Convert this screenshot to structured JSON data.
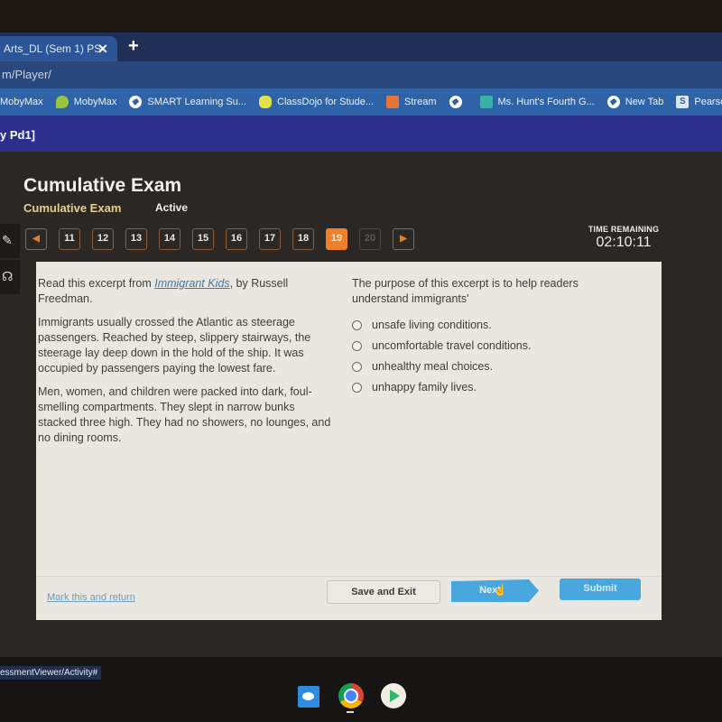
{
  "browser": {
    "tab_title": "Arts_DL (Sem 1) PS",
    "tab_close": "✕",
    "new_tab": "+",
    "url": "m/Player/",
    "bookmarks": [
      {
        "label": "MobyMax",
        "icon": "mobymax-icon"
      },
      {
        "label": "MobyMax",
        "icon": "mobymax-apple-icon"
      },
      {
        "label": "SMART Learning Su...",
        "icon": "globe-icon"
      },
      {
        "label": "ClassDojo for Stude...",
        "icon": "classdojo-icon"
      },
      {
        "label": "Stream",
        "icon": "google-classroom-icon"
      },
      {
        "label": "",
        "icon": "globe-icon"
      },
      {
        "label": "Ms. Hunt's Fourth G...",
        "icon": "google-classroom-icon"
      },
      {
        "label": "New Tab",
        "icon": "globe-icon"
      },
      {
        "label": "Pearson",
        "icon": "pearson-icon"
      }
    ]
  },
  "lms": {
    "header_title": "y Pd1]"
  },
  "activity": {
    "title": "Cumulative Exam",
    "subtitle": "Cumulative Exam",
    "status": "Active",
    "question_nav": {
      "prev_label": "◀",
      "next_label": "▶",
      "questions": [
        "11",
        "12",
        "13",
        "14",
        "15",
        "16",
        "17",
        "18",
        "19",
        "20"
      ],
      "current": "19",
      "disabled": [
        "20"
      ]
    },
    "timer": {
      "label": "TIME REMAINING",
      "value": "02:10:11"
    }
  },
  "question": {
    "intro_prefix": "Read this excerpt from ",
    "book_title": "Immigrant Kids",
    "intro_suffix": ", by Russell Freedman.",
    "paragraphs": [
      "Immigrants usually crossed the Atlantic as steerage passengers. Reached by steep, slippery stairways, the steerage lay deep down in the hold of the ship. It was occupied by passengers paying the lowest fare.",
      "Men, women, and children were packed into dark, foul-smelling compartments. They slept in narrow bunks stacked three high. They had no showers, no lounges, and no dining rooms."
    ],
    "prompt": "The purpose of this excerpt is to help readers understand immigrants'",
    "options": [
      "unsafe living conditions.",
      "uncomfortable travel conditions.",
      "unhealthy meal choices.",
      "unhappy family lives."
    ],
    "selected": null
  },
  "footer": {
    "mark_label": "Mark this and return",
    "save_label": "Save and Exit",
    "next_label": "Next",
    "submit_label": "Submit"
  },
  "status_bar": {
    "url": "essmentViewer/Activity#"
  },
  "colors": {
    "accent_orange": "#f07f2c",
    "button_blue": "#49a7de",
    "header_purple": "#2c2d8c",
    "subtitle_gold": "#e6cf8e"
  }
}
